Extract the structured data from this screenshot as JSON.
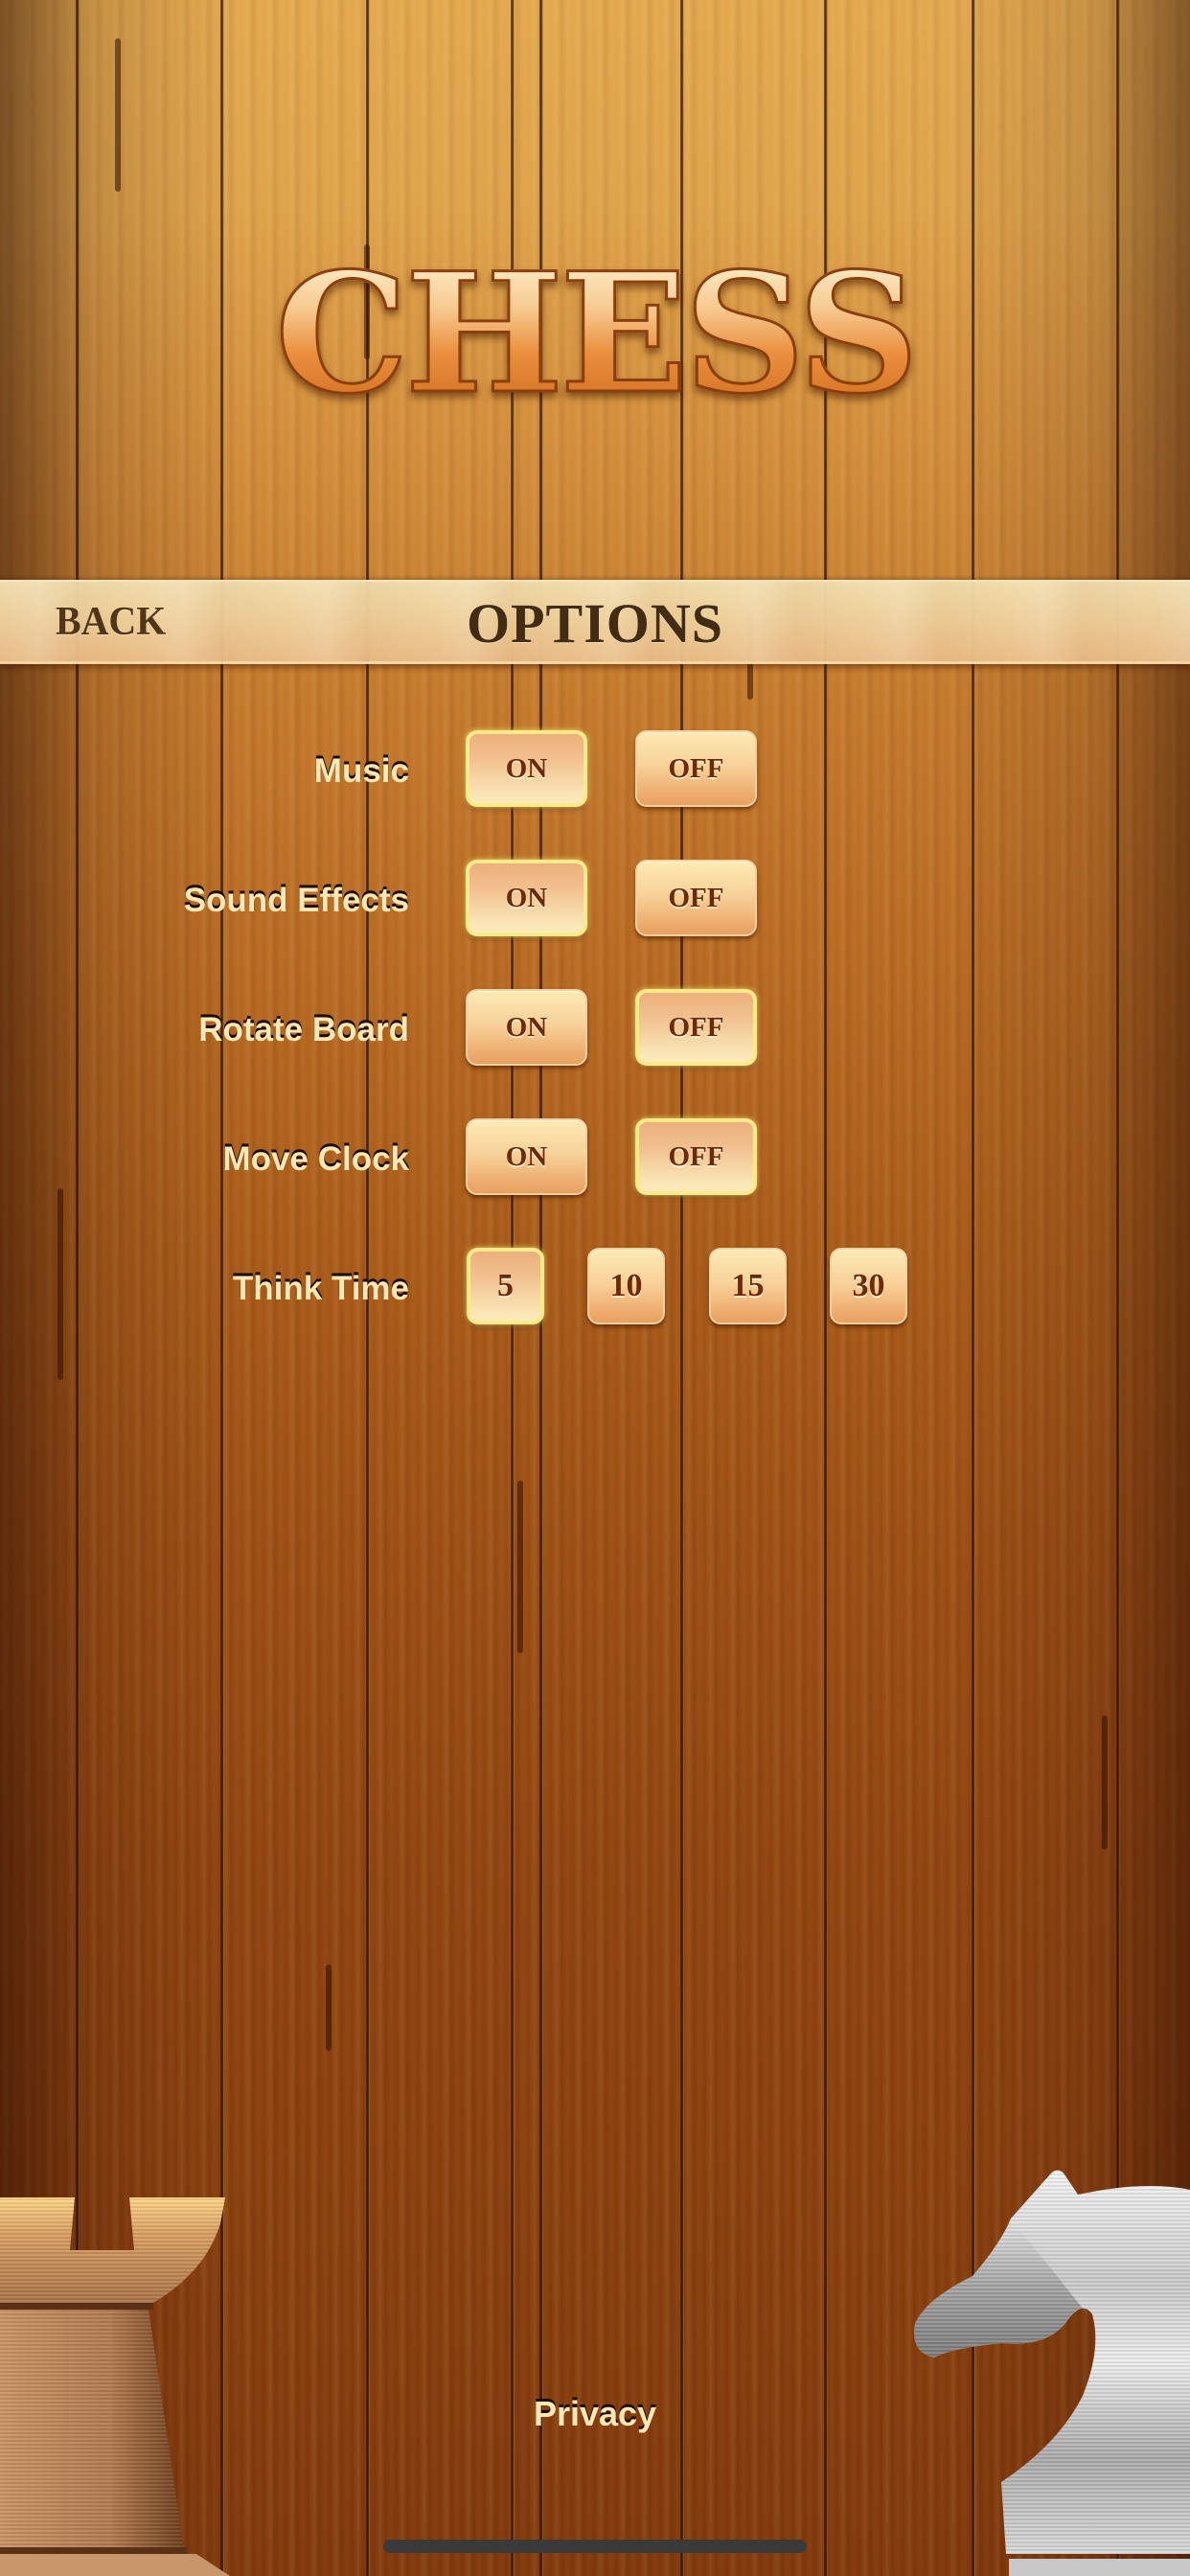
{
  "app": {
    "title": "CHESS"
  },
  "header": {
    "back_label": "BACK",
    "title": "OPTIONS"
  },
  "settings": [
    {
      "label": "Music",
      "options": [
        {
          "label": "ON",
          "selected": true
        },
        {
          "label": "OFF",
          "selected": false
        }
      ]
    },
    {
      "label": "Sound Effects",
      "options": [
        {
          "label": "ON",
          "selected": true
        },
        {
          "label": "OFF",
          "selected": false
        }
      ]
    },
    {
      "label": "Rotate Board",
      "options": [
        {
          "label": "ON",
          "selected": false
        },
        {
          "label": "OFF",
          "selected": true
        }
      ]
    },
    {
      "label": "Move Clock",
      "options": [
        {
          "label": "ON",
          "selected": false
        },
        {
          "label": "OFF",
          "selected": true
        }
      ]
    },
    {
      "label": "Think Time",
      "options": [
        {
          "label": "5",
          "selected": true
        },
        {
          "label": "10",
          "selected": false
        },
        {
          "label": "15",
          "selected": false
        },
        {
          "label": "30",
          "selected": false
        }
      ]
    }
  ],
  "footer": {
    "privacy_label": "Privacy"
  },
  "decorations": {
    "left_piece": "rook-icon",
    "right_piece": "knight-icon"
  },
  "colors": {
    "label_text": "#fde7b4",
    "button_text": "#6b2a08",
    "selected_border": "#fbea8a",
    "header_text": "#3e2a12"
  }
}
